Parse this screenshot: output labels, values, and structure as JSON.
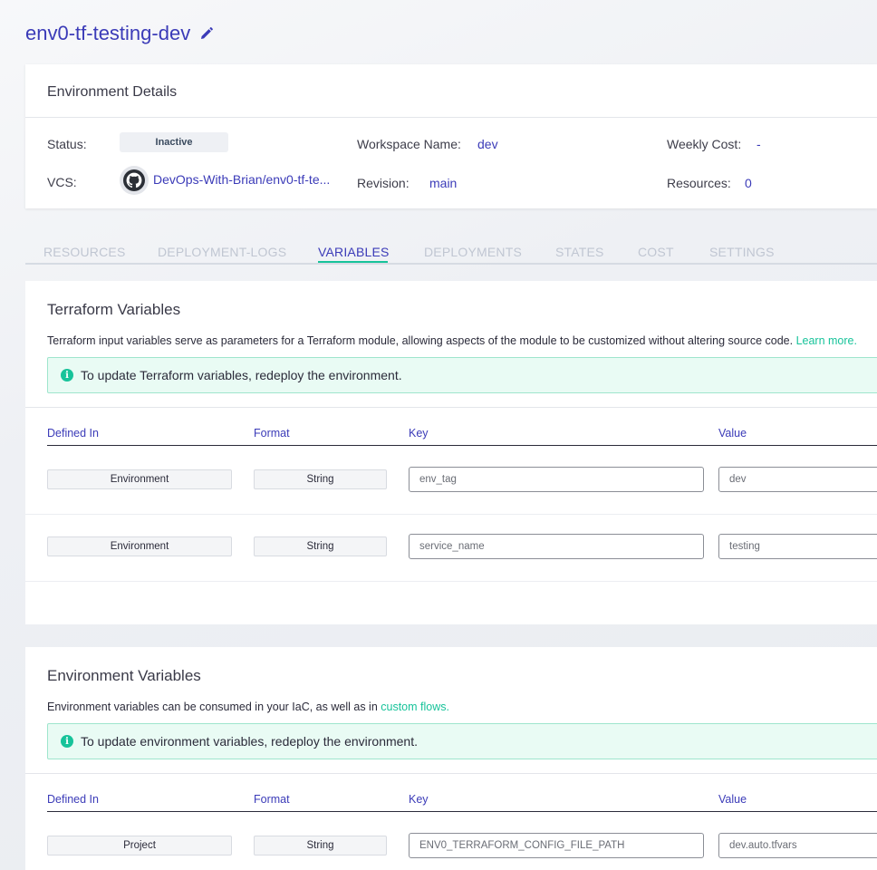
{
  "header": {
    "env_name": "env0-tf-testing-dev"
  },
  "details": {
    "title": "Environment Details",
    "status_label": "Status:",
    "status_value": "Inactive",
    "workspace_label": "Workspace Name:",
    "workspace_value": "dev",
    "weekly_cost_label": "Weekly Cost:",
    "weekly_cost_value": "-",
    "vcs_label": "VCS:",
    "vcs_value": "DevOps-With-Brian/env0-tf-te...",
    "revision_label": "Revision:",
    "revision_value": "main",
    "resources_label": "Resources:",
    "resources_value": "0"
  },
  "tabs": [
    {
      "label": "RESOURCES"
    },
    {
      "label": "DEPLOYMENT-LOGS"
    },
    {
      "label": "VARIABLES",
      "active": true
    },
    {
      "label": "DEPLOYMENTS"
    },
    {
      "label": "STATES"
    },
    {
      "label": "COST"
    },
    {
      "label": "SETTINGS"
    }
  ],
  "terraform": {
    "title": "Terraform Variables",
    "desc": "Terraform input variables serve as parameters for a Terraform module, allowing aspects of the module to be customized without altering source code.",
    "learn_more": "Learn more.",
    "notice": "To update Terraform variables, redeploy the environment.",
    "columns": {
      "defined_in": "Defined In",
      "format": "Format",
      "key": "Key",
      "value": "Value"
    },
    "rows": [
      {
        "defined_in": "Environment",
        "format": "String",
        "key": "env_tag",
        "value": "dev"
      },
      {
        "defined_in": "Environment",
        "format": "String",
        "key": "service_name",
        "value": "testing"
      }
    ]
  },
  "environment": {
    "title": "Environment Variables",
    "desc": "Environment variables can be consumed in your IaC, as well as in",
    "custom_flows": "custom flows.",
    "notice": "To update environment variables, redeploy the environment.",
    "columns": {
      "defined_in": "Defined In",
      "format": "Format",
      "key": "Key",
      "value": "Value"
    },
    "rows": [
      {
        "defined_in": "Project",
        "format": "String",
        "key": "ENV0_TERRAFORM_CONFIG_FILE_PATH",
        "value": "dev.auto.tfvars"
      }
    ]
  },
  "colors": {
    "accent": "#3b3bb8",
    "green": "#17c39a"
  },
  "icons": {
    "edit": "pencil-icon",
    "vcs": "github-icon",
    "info": "info-icon"
  }
}
